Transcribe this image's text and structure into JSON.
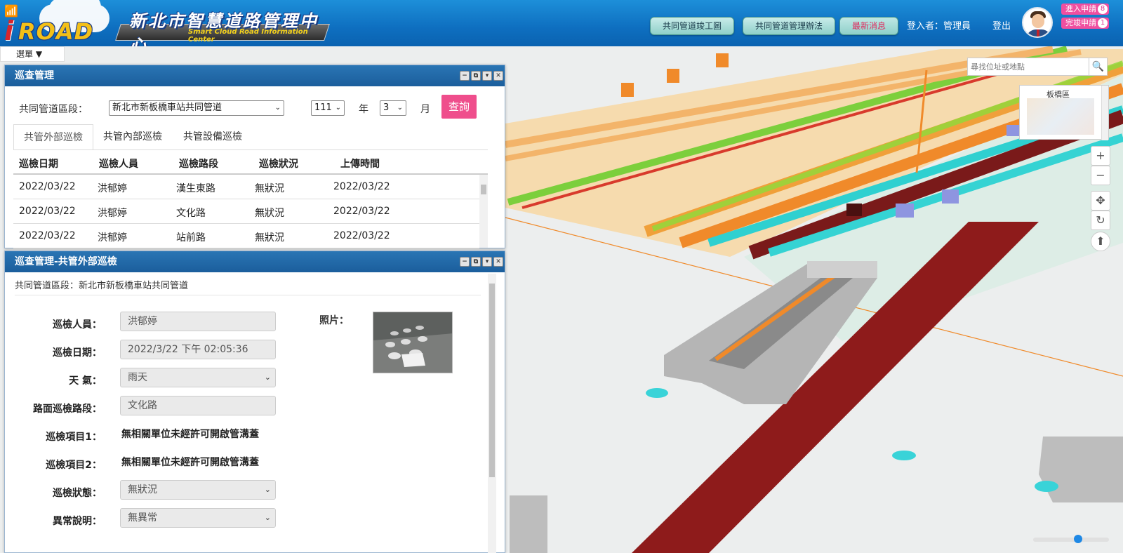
{
  "header": {
    "logo_text": "ROAD",
    "logo_i": "i",
    "title_zh": "新北市智慧道路管理中心",
    "title_en": "Smart Cloud Road Information Center",
    "buttons": [
      "共同管道竣工圖",
      "共同管道管理辦法",
      "最新消息"
    ],
    "login_label": "登入者：管理員",
    "logout_label": "登出",
    "badges": [
      {
        "label": "進入申請",
        "count": "8"
      },
      {
        "label": "完竣申請",
        "count": "1"
      }
    ]
  },
  "menu": {
    "label": "選單 ▼"
  },
  "map": {
    "search_placeholder": "尋找位址或地點",
    "overview_label": "板橋區",
    "zoom_in": "+",
    "zoom_out": "−",
    "pan": "✥",
    "rotate": "↻",
    "compass": "⬆",
    "zoom_level": 0.6
  },
  "panel1": {
    "title": "巡查管理",
    "section_label": "共同管道區段：",
    "section_value": "新北市新板橋車站共同管道",
    "year_value": "111",
    "year_label": "年",
    "month_value": "3",
    "month_label": "月",
    "query_label": "查詢",
    "tabs": [
      "共管外部巡檢",
      "共管內部巡檢",
      "共管設備巡檢"
    ],
    "columns": [
      "巡檢日期",
      "巡檢人員",
      "巡檢路段",
      "巡檢狀況",
      "上傳時間"
    ],
    "rows": [
      [
        "2022/03/22",
        "洪郁婷",
        "漢生東路",
        "無狀況",
        "2022/03/22"
      ],
      [
        "2022/03/22",
        "洪郁婷",
        "文化路",
        "無狀況",
        "2022/03/22"
      ],
      [
        "2022/03/22",
        "洪郁婷",
        "站前路",
        "無狀況",
        "2022/03/22"
      ]
    ]
  },
  "panel2": {
    "title": "巡查管理-共管外部巡檢",
    "subtitle": "共同管道區段：新北市新板橋車站共同管道",
    "fields": {
      "inspector_label": "巡檢人員：",
      "inspector_value": "洪郁婷",
      "date_label": "巡檢日期：",
      "date_value": "2022/3/22 下午 02:05:36",
      "weather_label": "天 氣：",
      "weather_value": "雨天",
      "road_label": "路面巡檢路段：",
      "road_value": "文化路",
      "item1_label": "巡檢項目1：",
      "item1_value": "無相關單位未經許可開啟管溝蓋",
      "item2_label": "巡檢項目2：",
      "item2_value": "無相關單位未經許可開啟管溝蓋",
      "status_label": "巡檢狀態：",
      "status_value": "無狀況",
      "anomaly_label": "異常說明：",
      "anomaly_value": "無異常",
      "photo_label": "照片："
    }
  }
}
